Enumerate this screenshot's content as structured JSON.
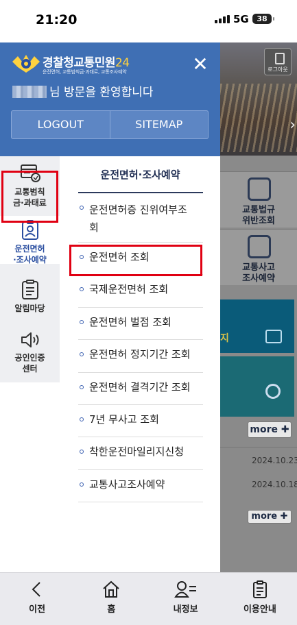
{
  "status_bar": {
    "time": "21:20",
    "network": "5G",
    "battery": "38"
  },
  "drawer": {
    "brand": {
      "title": "경찰청교통민원",
      "title_num": "24",
      "subtitle": "운전면허, 교통범칙금·과태료, 교통조사예약"
    },
    "welcome_text": "님 방문을 환영합니다",
    "buttons": {
      "logout": "LOGOUT",
      "sitemap": "SITEMAP"
    },
    "left_nav": [
      {
        "label_1": "교통범칙",
        "label_2": "금·과태료",
        "icon": "fine-card-icon"
      },
      {
        "label_1": "운전면허",
        "label_2": "·조사예약",
        "icon": "license-icon",
        "active": true
      },
      {
        "label_1": "알림마당",
        "label_2": "",
        "icon": "notice-board-icon"
      },
      {
        "label_1": "공인인증",
        "label_2": "센터",
        "icon": "speaker-icon"
      }
    ],
    "submenu": {
      "title": "운전면허·조사예약",
      "items": [
        {
          "label_1": "운전면허증 진위여부조",
          "label_2": "회"
        },
        {
          "label_1": "운전면허 조회"
        },
        {
          "label_1": "국제운전면허 조회"
        },
        {
          "label_1": "운전면허 벌점 조회"
        },
        {
          "label_1": "운전면허 정지기간 조회"
        },
        {
          "label_1": "운전면허 결격기간 조회"
        },
        {
          "label_1": "7년 무사고 조회"
        },
        {
          "label_1": "착한운전마일리지신청"
        },
        {
          "label_1": "교통사고조사예약"
        }
      ]
    }
  },
  "background_page": {
    "logout_label": "로그아웃",
    "tiles": [
      {
        "label_1": "교통법규",
        "label_2": "위반조회"
      },
      {
        "label_1": "교통사고",
        "label_2": "조사예약"
      }
    ],
    "banner_text": "지",
    "more_label": "more",
    "dates": [
      "2024.10.23",
      "2024.10.18"
    ]
  },
  "bottom_bar": [
    {
      "label": "이전",
      "icon": "back-icon"
    },
    {
      "label": "홈",
      "icon": "home-icon"
    },
    {
      "label": "내정보",
      "icon": "my-info-icon"
    },
    {
      "label": "이용안내",
      "icon": "guide-icon"
    }
  ],
  "colors": {
    "header_blue": "#3f6fb4",
    "highlight_red": "#e00012",
    "brand_yellow": "#ffd23f"
  }
}
